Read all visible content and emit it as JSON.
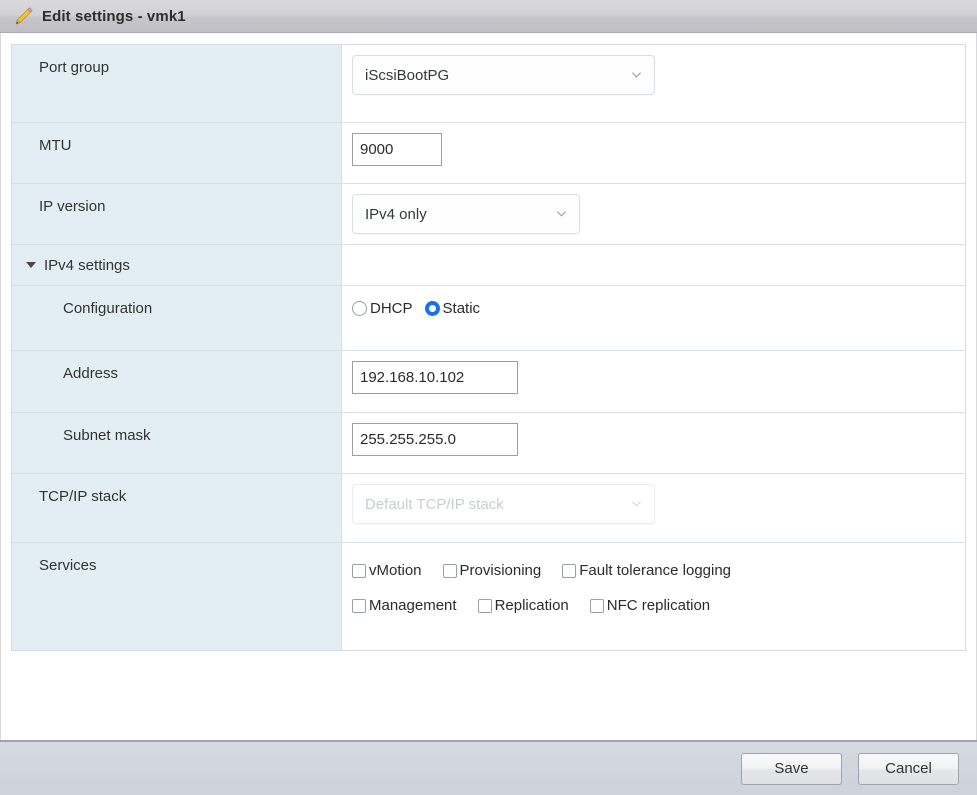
{
  "window": {
    "title": "Edit settings - vmk1",
    "icon": "pencil-icon"
  },
  "form": {
    "port_group": {
      "label": "Port group",
      "value": "iScsiBootPG",
      "control": "select"
    },
    "mtu": {
      "label": "MTU",
      "value": "9000",
      "control": "text"
    },
    "ip_version": {
      "label": "IP version",
      "value": "IPv4 only",
      "control": "select"
    },
    "ipv4_section": {
      "label": "IPv4 settings",
      "expanded": true
    },
    "configuration": {
      "label": "Configuration",
      "options": [
        {
          "label": "DHCP",
          "selected": false
        },
        {
          "label": "Static",
          "selected": true
        }
      ]
    },
    "address": {
      "label": "Address",
      "value": "192.168.10.102",
      "control": "text"
    },
    "subnet_mask": {
      "label": "Subnet mask",
      "value": "255.255.255.0",
      "control": "text"
    },
    "tcpip_stack": {
      "label": "TCP/IP stack",
      "value": "Default TCP/IP stack",
      "control": "select",
      "disabled": true
    },
    "services": {
      "label": "Services",
      "row1": [
        {
          "label": "vMotion",
          "checked": false
        },
        {
          "label": "Provisioning",
          "checked": false
        },
        {
          "label": "Fault tolerance logging",
          "checked": false
        }
      ],
      "row2": [
        {
          "label": "Management",
          "checked": false
        },
        {
          "label": "Replication",
          "checked": false
        },
        {
          "label": "NFC replication",
          "checked": false
        }
      ]
    }
  },
  "footer": {
    "save_label": "Save",
    "cancel_label": "Cancel"
  },
  "colors": {
    "label_column": "#e2eef4",
    "radio_selected": "#1673e6",
    "titlebar": "#d3d3d7",
    "footer": "#ced3dc"
  }
}
